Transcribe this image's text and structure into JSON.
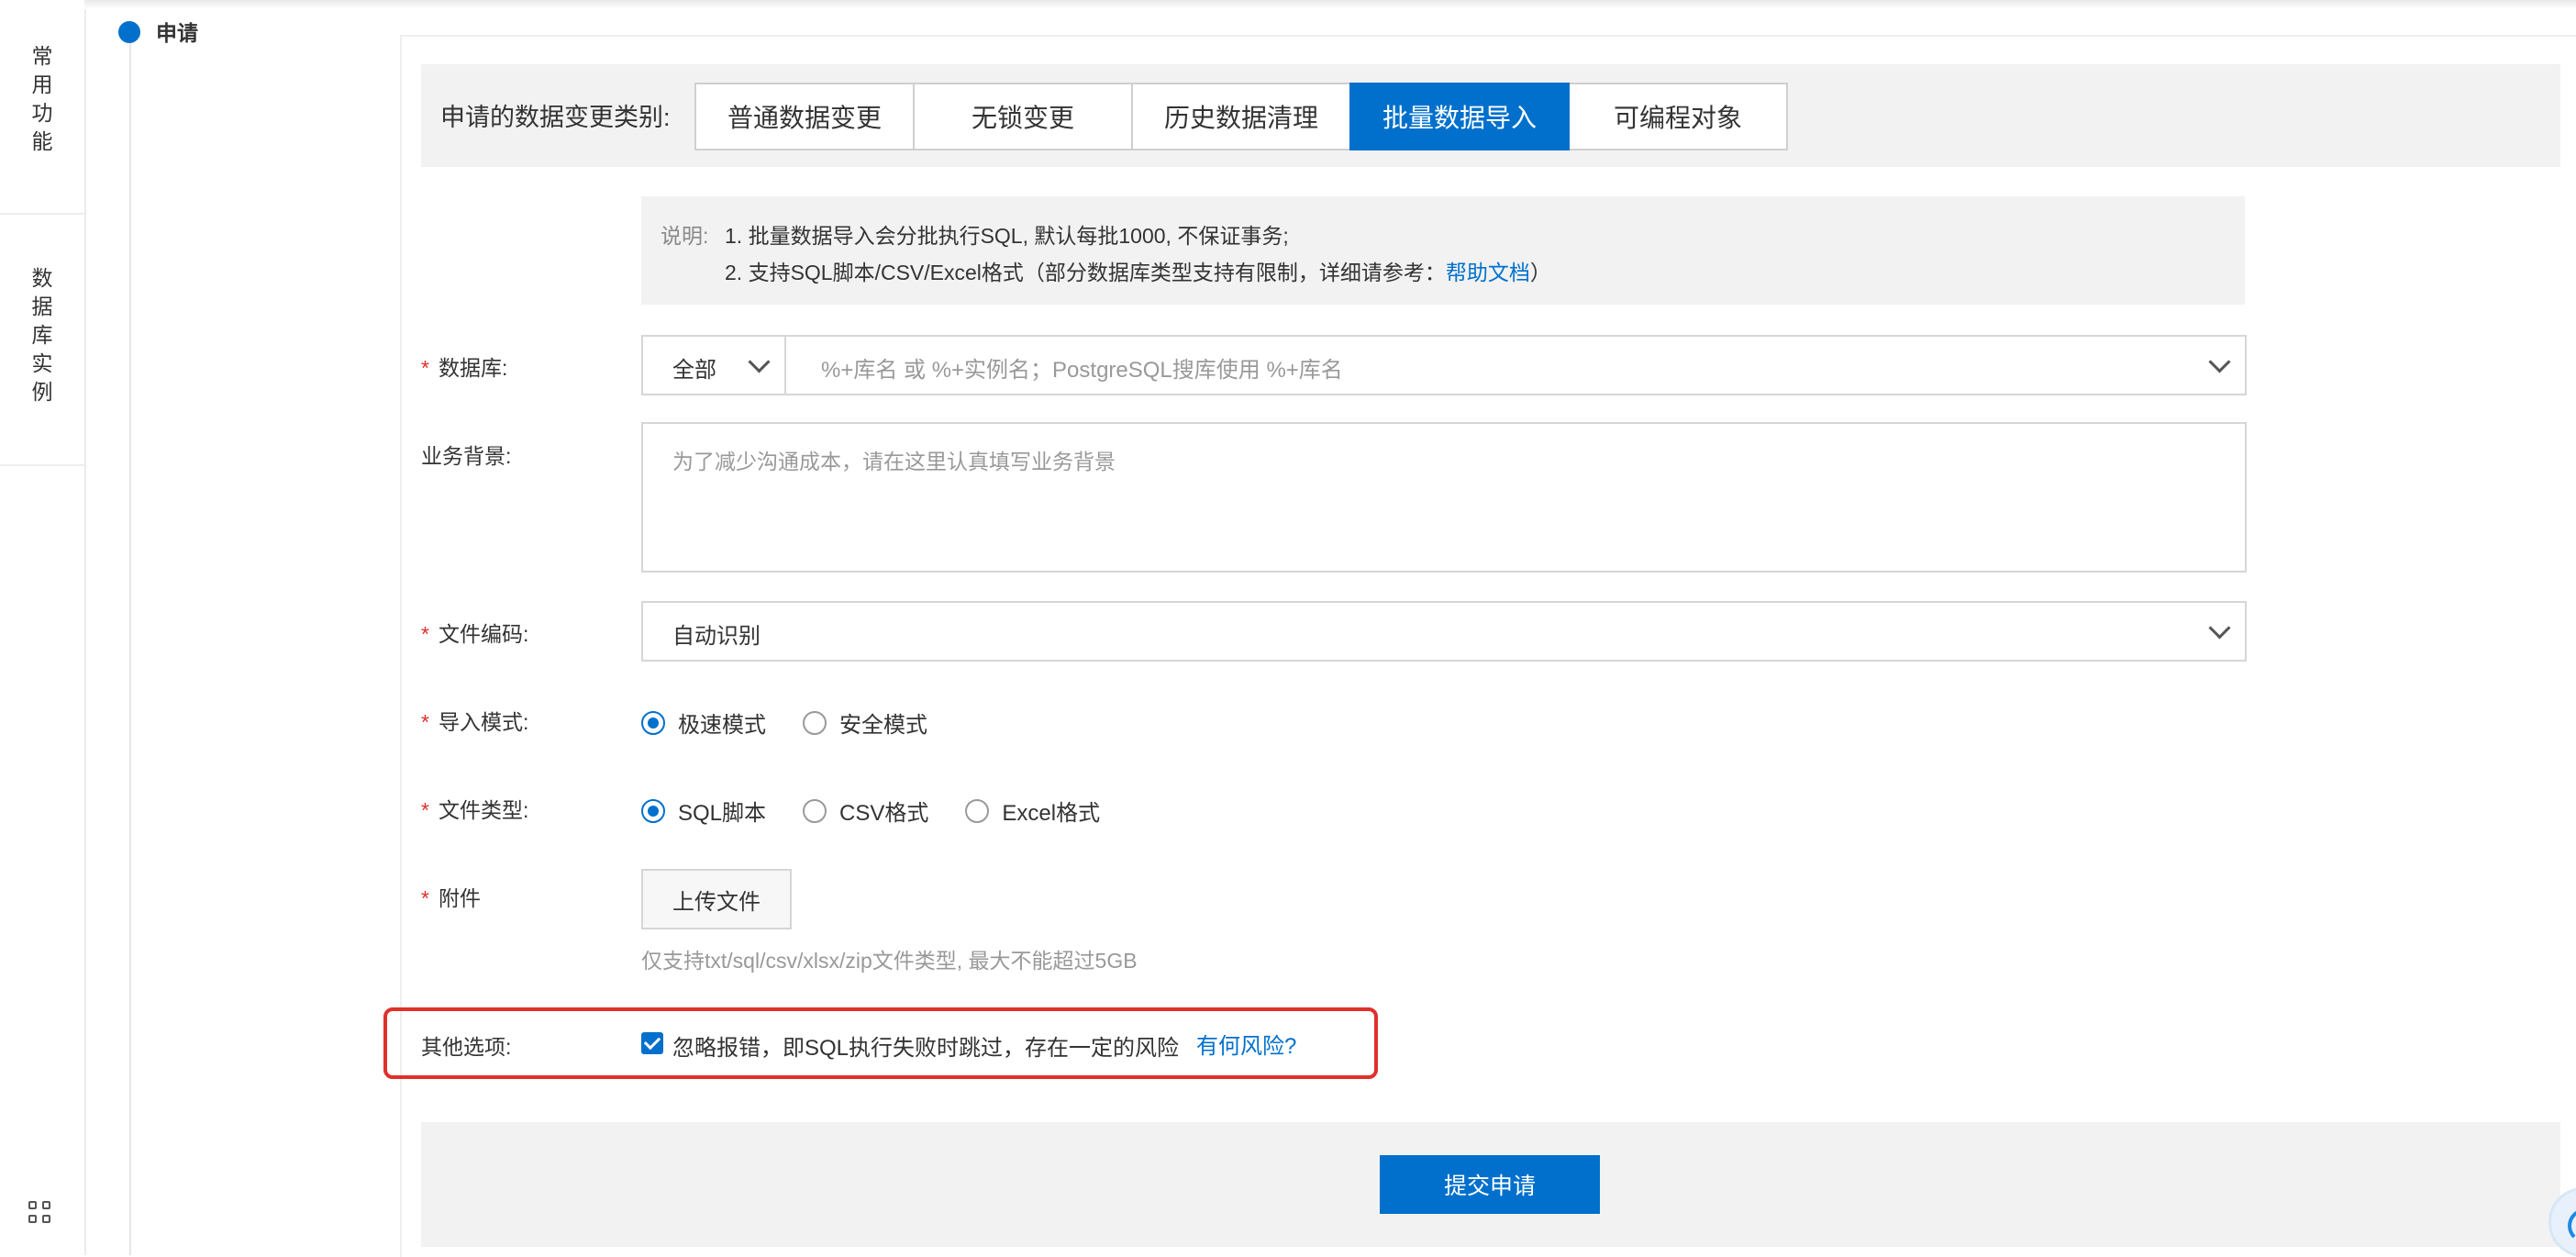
{
  "rail": {
    "group1": [
      "常",
      "用",
      "功",
      "能"
    ],
    "group2": [
      "数",
      "据",
      "库",
      "实",
      "例"
    ]
  },
  "timeline": {
    "title": "申请"
  },
  "category": {
    "label": "申请的数据变更类别:",
    "tabs": [
      "普通数据变更",
      "无锁变更",
      "历史数据清理",
      "批量数据导入",
      "可编程对象"
    ],
    "active": "批量数据导入"
  },
  "note": {
    "prefix": "说明:",
    "line1": "1. 批量数据导入会分批执行SQL, 默认每批1000, 不保证事务;",
    "line2_pre": "2. 支持SQL脚本/CSV/Excel格式（部分数据库类型支持有限制，详细请参考：",
    "line2_link": "帮助文档",
    "line2_post": "）"
  },
  "form": {
    "required_mark": "*",
    "database": {
      "label": "数据库:",
      "scope": "全部",
      "placeholder": "%+库名 或 %+实例名；PostgreSQL搜库使用 %+库名"
    },
    "background": {
      "label": "业务背景:",
      "placeholder": "为了减少沟通成本，请在这里认真填写业务背景"
    },
    "encoding": {
      "label": "文件编码:",
      "value": "自动识别"
    },
    "import_mode": {
      "label": "导入模式:",
      "options": [
        "极速模式",
        "安全模式"
      ],
      "selected": "极速模式"
    },
    "file_type": {
      "label": "文件类型:",
      "options": [
        "SQL脚本",
        "CSV格式",
        "Excel格式"
      ],
      "selected": "SQL脚本"
    },
    "attachment": {
      "label": "附件",
      "button": "上传文件",
      "hint": "仅支持txt/sql/csv/xlsx/zip文件类型, 最大不能超过5GB"
    },
    "other": {
      "label": "其他选项:",
      "checkbox_text": "忽略报错，即SQL执行失败时跳过，存在一定的风险",
      "checked": true,
      "risk_link": "有何风险?"
    }
  },
  "submit": {
    "label": "提交申请"
  },
  "colors": {
    "primary": "#0070cc",
    "highlight": "#e0302a",
    "required": "#e12d2d"
  }
}
